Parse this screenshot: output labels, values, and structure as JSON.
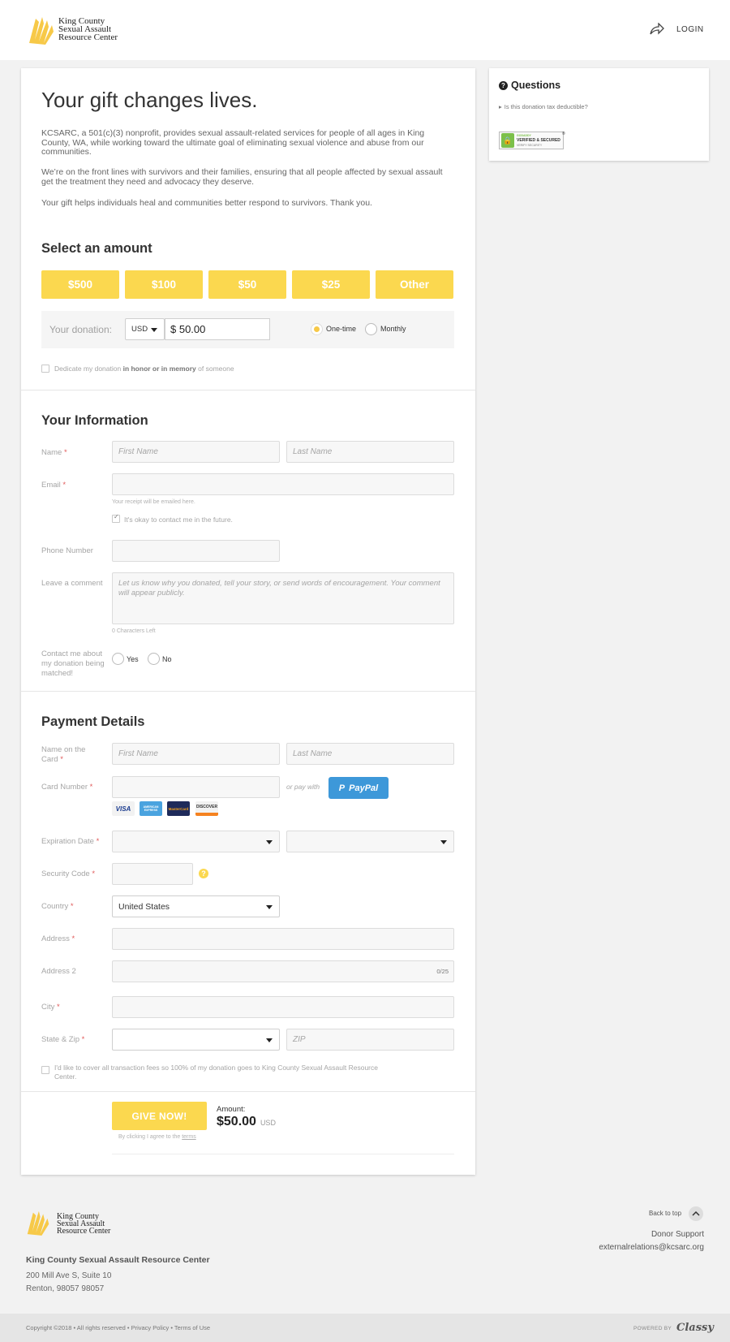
{
  "header": {
    "logo_text": [
      "King County",
      "Sexual Assault",
      "Resource Center"
    ],
    "login_label": "LOGIN",
    "share_icon": "share-arrow-icon"
  },
  "intro": {
    "title": "Your gift changes lives.",
    "paragraphs": [
      "KCSARC, a 501(c)(3) nonprofit, provides sexual assault-related services for people of all ages in King County, WA, while working toward the ultimate goal of eliminating sexual violence and abuse from our communities.",
      "We’re on the front lines with survivors and their families, ensuring that all people affected by sexual assault get the treatment they need and advocacy they deserve.",
      "Your gift helps individuals heal and communities better respond to survivors. Thank you."
    ]
  },
  "amount": {
    "heading": "Select an amount",
    "options": [
      "$500",
      "$100",
      "$50",
      "$25",
      "Other"
    ],
    "your_donation_label": "Your donation:",
    "currency": "USD",
    "value": "$ 50.00",
    "frequency": [
      "One-time",
      "Monthly"
    ],
    "dedicate": {
      "pre": "Dedicate my donation ",
      "bold": "in honor or in memory",
      "post": " of someone"
    }
  },
  "info": {
    "heading": "Your Information",
    "name_label": "Name",
    "first_placeholder": "First Name",
    "last_placeholder": "Last Name",
    "email_label": "Email",
    "email_help": "Your receipt will be emailed here.",
    "contact_ok": "It's okay to contact me in the future.",
    "phone_label": "Phone Number",
    "comment_label": "Leave a comment",
    "comment_placeholder": "Let us know why you donated, tell your story, or send words of encouragement. Your comment will appear publicly.",
    "chars_left": "0 Characters Left",
    "match_label": "Contact me about my donation being matched!",
    "match_options": [
      "Yes",
      "No"
    ]
  },
  "payment": {
    "heading": "Payment Details",
    "name_on_card_label": "Name on the Card",
    "first_placeholder": "First Name",
    "last_placeholder": "Last Name",
    "card_number_label": "Card Number",
    "or_pay_with": "or pay with",
    "paypal_label": "PayPal",
    "card_brands": [
      "VISA",
      "AMERICAN EXPRESS",
      "MasterCard",
      "DISCOVER"
    ],
    "expiration_label": "Expiration Date",
    "security_label": "Security Code",
    "country_label": "Country",
    "country_value": "United States",
    "address_label": "Address",
    "address2_label": "Address 2",
    "address2_counter": "0/25",
    "city_label": "City",
    "state_zip_label": "State & Zip",
    "zip_placeholder": "ZIP",
    "cover_fees": "I'd like to cover all transaction fees so 100% of my donation goes to King County Sexual Assault Resource Center."
  },
  "submit": {
    "button_label": "GIVE NOW!",
    "amount_label": "Amount:",
    "amount_value": "$50.00",
    "amount_currency": "USD",
    "terms_pre": "By clicking I agree to the ",
    "terms_link": "terms"
  },
  "sidebar": {
    "title": "Questions",
    "link": "Is this donation tax deductible?",
    "badge_top": "GODADDY",
    "badge_mid": "VERIFIED & SECURED",
    "badge_bot": "VERIFY SECURITY"
  },
  "footer": {
    "logo_text": [
      "King County",
      "Sexual Assault",
      "Resource Center"
    ],
    "org_name": "King County Sexual Assault Resource Center",
    "address1": "200 Mill Ave S, Suite 10",
    "address2": "Renton, 98057 98057",
    "back_to_top": "Back to top",
    "support_label": "Donor Support",
    "support_email": "externalrelations@kcsarc.org",
    "copyright": "Copyright ©2018 • All rights reserved • Privacy Policy • Terms of Use",
    "powered_by": "POWERED BY",
    "brand": "Classy"
  },
  "colors": {
    "accent": "#fbd84f",
    "paypal": "#3d98d9",
    "required": "#e05a5a"
  }
}
